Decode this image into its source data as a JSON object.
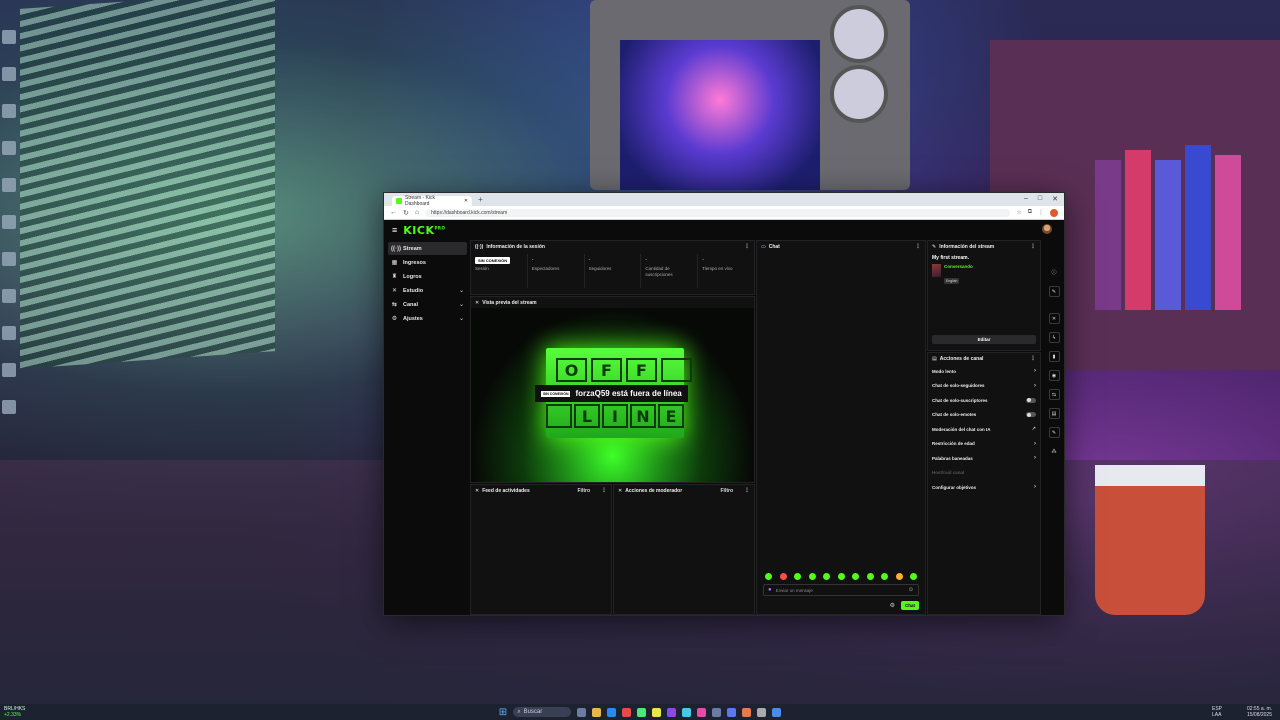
{
  "browser": {
    "tab_title": "Stream - Kick Dashboard",
    "url": "https://dashboard.kick.com/stream"
  },
  "app": {
    "logo": "KICK",
    "logo_sup": "PRO"
  },
  "sidebar": {
    "items": [
      {
        "label": "Stream",
        "icon": "stream-icon",
        "active": true
      },
      {
        "label": "Ingresos",
        "icon": "revenue-icon"
      },
      {
        "label": "Logros",
        "icon": "trophy-icon"
      },
      {
        "label": "Estudio",
        "icon": "studio-icon",
        "expandable": true
      },
      {
        "label": "Canal",
        "icon": "channel-icon",
        "expandable": true
      },
      {
        "label": "Ajustes",
        "icon": "settings-icon",
        "expandable": true
      }
    ]
  },
  "session": {
    "title": "Información de la sesión",
    "status_badge": "SIN CONEXIÓN",
    "stats": [
      {
        "value": "",
        "label": "Sesión"
      },
      {
        "value": "-",
        "label": "Espectadores"
      },
      {
        "value": "-",
        "label": "Seguidores"
      },
      {
        "value": "-",
        "label": "Cantidad de suscripciones"
      },
      {
        "value": "-",
        "label": "Tiempo en vivo"
      }
    ]
  },
  "preview": {
    "title": "Vista previa del stream",
    "sign_top": [
      "O",
      "F",
      "F",
      ""
    ],
    "sign_bottom": [
      "",
      "L",
      "I",
      "N",
      "E"
    ],
    "badge": "SIN CONEXIÓN",
    "message": "forzaQ59 está fuera de línea"
  },
  "activity": {
    "title": "Feed de actividades",
    "filter": "Filtro"
  },
  "moderator": {
    "title": "Acciones de moderador",
    "filter": "Filtro"
  },
  "chat": {
    "title": "Chat",
    "placeholder": "Enviar un mensaje",
    "send": "Chat"
  },
  "stream_info": {
    "title": "Información del stream",
    "stream_title": "My first stream.",
    "category": "Conversando",
    "language": "English",
    "edit": "Editar"
  },
  "channel_actions": {
    "title": "Acciones de canal",
    "items": [
      {
        "label": "Modo lento",
        "control": "chevron"
      },
      {
        "label": "Chat de solo-seguidores",
        "control": "chevron"
      },
      {
        "label": "Chat de solo-suscriptores",
        "control": "toggle"
      },
      {
        "label": "Chat de solo-emotes",
        "control": "toggle"
      },
      {
        "label": "Moderación del chat con IA",
        "control": "external"
      },
      {
        "label": "Restricción de edad",
        "control": "chevron"
      },
      {
        "label": "Palabras baneadas",
        "control": "chevron"
      },
      {
        "label": "Host/raid canal",
        "control": "none",
        "disabled": true
      },
      {
        "label": "Configurar objetivos",
        "control": "chevron"
      }
    ]
  },
  "taskbar": {
    "search": "Buscar",
    "left_line1": "BRL/HKS",
    "left_line2": "+2.33%",
    "lang_line1": "ESP",
    "lang_line2": "LAA",
    "time": "02:55 a. m.",
    "date": "15/08/2025"
  },
  "colors": {
    "kick_green": "#53fc18",
    "panel_bg": "#111112",
    "app_bg": "#0b0b0c"
  }
}
